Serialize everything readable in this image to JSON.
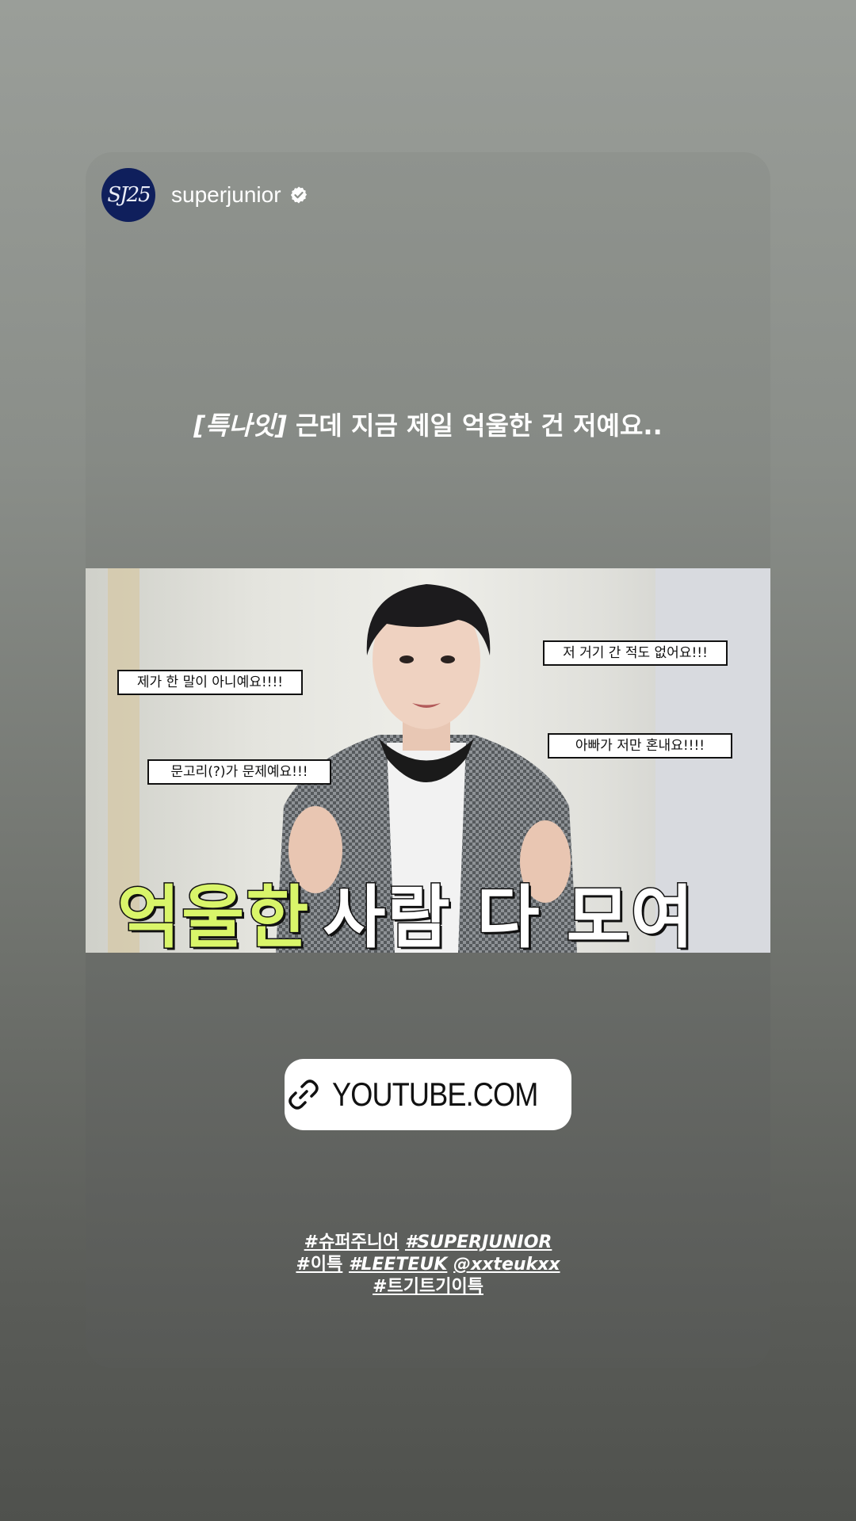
{
  "story": {
    "avatar_text": "SJ25",
    "username": "superjunior",
    "verified_icon": "verified-badge-icon"
  },
  "post": {
    "caption_bracket": "[특나잇]",
    "caption_text": " 근데 지금 제일 억울한 건 저예요..",
    "thumbnail": {
      "bubble1": "제가 한 말이 아니예요!!!!",
      "bubble2": "문고리(?)가 문제예요!!!",
      "bubble3": "저 거기 간 적도 없어요!!!",
      "bubble4": "아빠가 저만 혼내요!!!!",
      "headline_highlight": "억울한",
      "headline_rest": "사람 다 모여"
    }
  },
  "link_sticker": {
    "icon": "link-icon",
    "label": "YOUTUBE.COM"
  },
  "hashtags": {
    "line1_tag1": "#슈퍼주니어",
    "line1_tag2": "#SUPERJUNIOR",
    "line2_tag1": "#이특",
    "line2_tag2": "#LEETEUK",
    "line2_mention": "@xxteukxx",
    "line3_tag1": "#트기트기이특"
  },
  "colors": {
    "avatar_bg": "#0f1f5c",
    "headline_highlight": "#d9f56a",
    "sticker_bg": "#ffffff"
  }
}
